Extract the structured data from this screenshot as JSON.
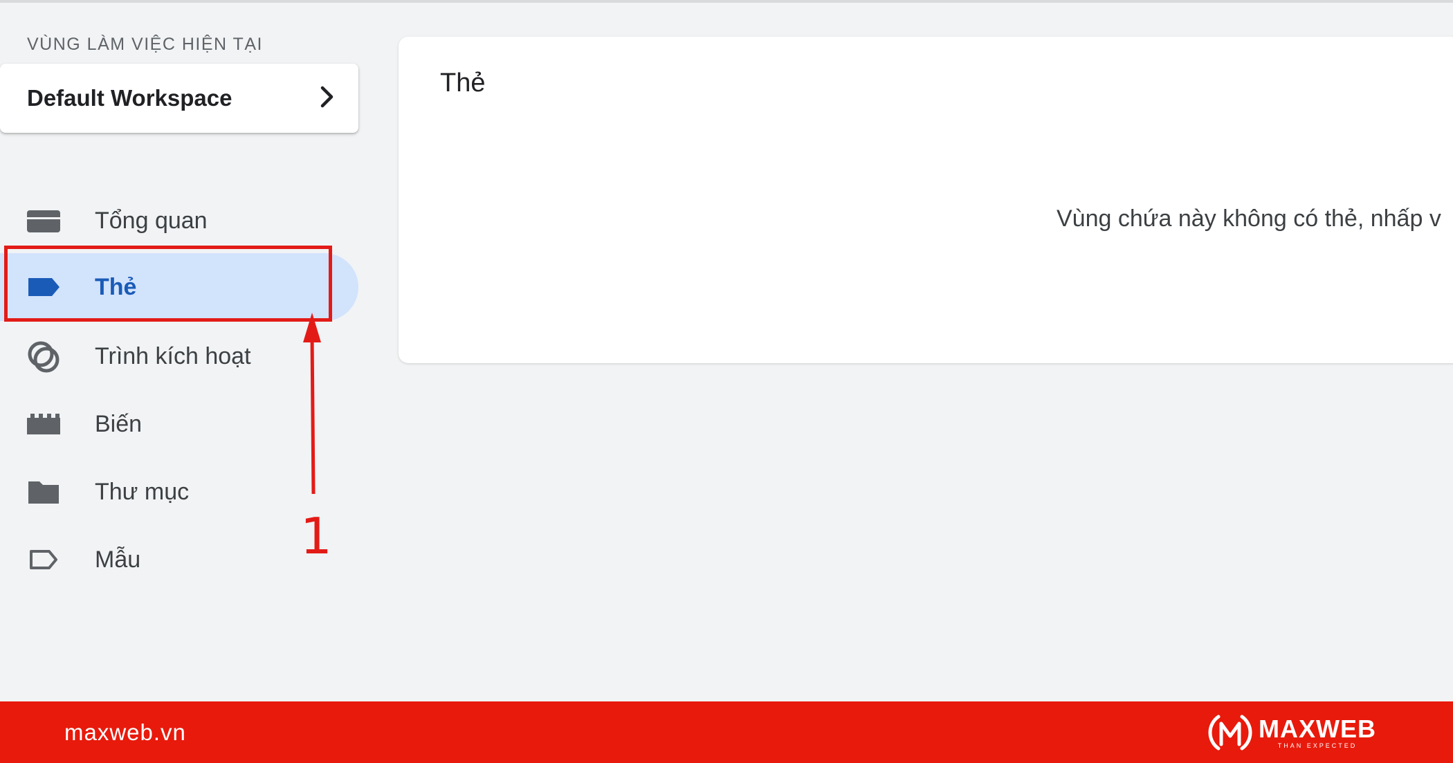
{
  "workspace": {
    "label": "VÙNG LÀM VIỆC HIỆN TẠI",
    "name": "Default Workspace"
  },
  "nav": {
    "items": [
      {
        "label": "Tổng quan",
        "icon": "overview-icon"
      },
      {
        "label": "Thẻ",
        "icon": "tag-icon",
        "active": true
      },
      {
        "label": "Trình kích hoạt",
        "icon": "trigger-icon"
      },
      {
        "label": "Biến",
        "icon": "variable-icon"
      },
      {
        "label": "Thư mục",
        "icon": "folder-icon"
      },
      {
        "label": "Mẫu",
        "icon": "template-icon"
      }
    ]
  },
  "main": {
    "title": "Thẻ",
    "message": "Vùng chứa này không có thẻ, nhấp v"
  },
  "annotation": {
    "number": "1",
    "color": "#e31b17"
  },
  "footer": {
    "domain": "maxweb.vn",
    "logo_name": "MAXWEB",
    "logo_tagline": "THAN EXPECTED",
    "color": "#e81a0c"
  },
  "colors": {
    "active_bg": "#d2e3fc",
    "active_text": "#1a5bb7"
  }
}
